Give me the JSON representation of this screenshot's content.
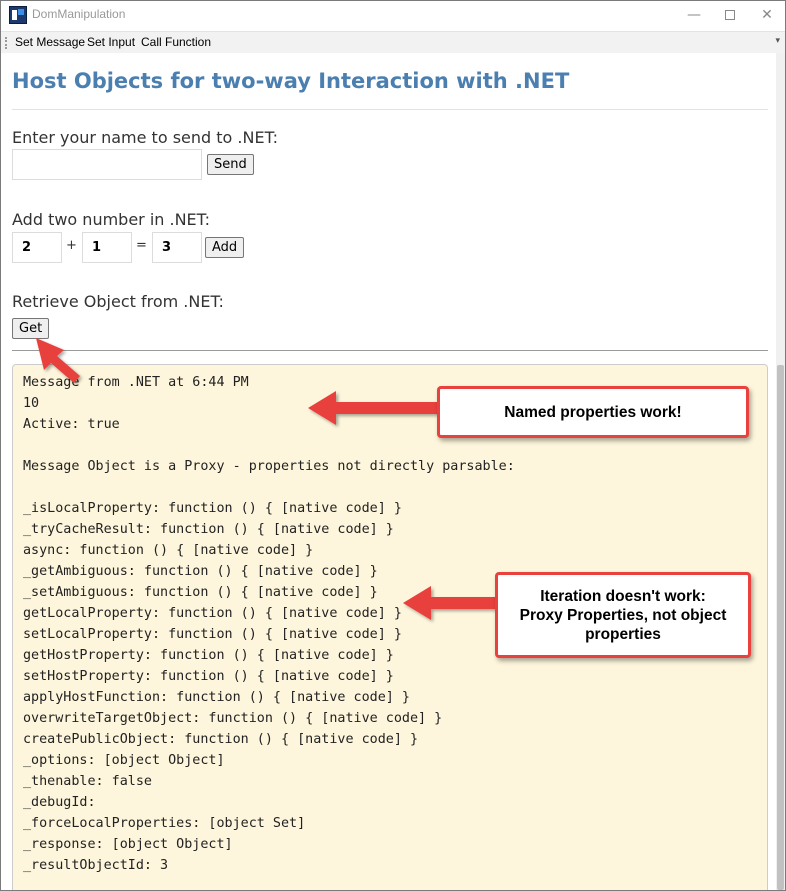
{
  "window": {
    "title": "DomManipulation",
    "minimize_glyph": "—",
    "close_glyph": "✕"
  },
  "menu": {
    "items": [
      "Set Message",
      "Set Input",
      "Call Function"
    ],
    "overflow_glyph": "▾"
  },
  "page": {
    "heading": "Host Objects for two-way Interaction with .NET",
    "name_section": {
      "label": "Enter your name to send to .NET:",
      "value": "",
      "button": "Send"
    },
    "add_section": {
      "label": "Add two number in .NET:",
      "a": "2",
      "plus": "+",
      "b": "1",
      "equals": "=",
      "result": "3",
      "button": "Add"
    },
    "retrieve_section": {
      "label": "Retrieve Object from .NET:",
      "button": "Get"
    },
    "output_lines": [
      "Message from .NET at 6:44 PM",
      "10",
      "Active: true",
      "",
      "Message Object is a Proxy - properties not directly parsable:",
      "",
      "_isLocalProperty: function () { [native code] }",
      "_tryCacheResult: function () { [native code] }",
      "async: function () { [native code] }",
      "_getAmbiguous: function () { [native code] }",
      "_setAmbiguous: function () { [native code] }",
      "getLocalProperty: function () { [native code] }",
      "setLocalProperty: function () { [native code] }",
      "getHostProperty: function () { [native code] }",
      "setHostProperty: function () { [native code] }",
      "applyHostFunction: function () { [native code] }",
      "overwriteTargetObject: function () { [native code] }",
      "createPublicObject: function () { [native code] }",
      "_options: [object Object]",
      "_thenable: false",
      "_debugId:",
      "_forceLocalProperties: [object Set]",
      "_response: [object Object]",
      "_resultObjectId: 3"
    ]
  },
  "annotations": {
    "callout_1": "Named properties work!",
    "callout_2_lines": [
      "Iteration doesn't work:",
      "Proxy Properties, not object",
      "properties"
    ],
    "color": "#e8413e"
  },
  "colors": {
    "heading": "#4a7fb0",
    "output_background": "#fef6dc"
  }
}
